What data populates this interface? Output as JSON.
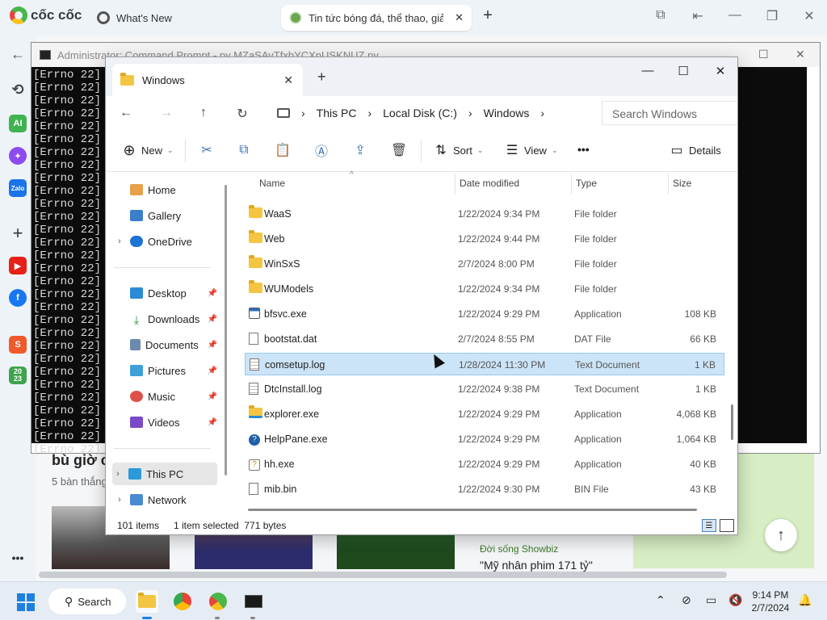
{
  "browser": {
    "logo_text": "cốc cốc",
    "tabs": [
      {
        "label": "What's New",
        "active": false
      },
      {
        "label": "Tin tức bóng đá, thể thao, giả",
        "active": true
      }
    ],
    "new_tab": "+",
    "page": {
      "headline": "bù giờ c",
      "subline": "5 bàn thắng",
      "category": "Đời sống Showbiz",
      "headline2": "\"Mỹ nhân phim 171 tỷ\"",
      "colors": {
        "category": "#3d7a2b",
        "promo_block": "#d7edc3"
      }
    }
  },
  "cmd": {
    "title": "Administrator: Command Prompt - py  MZaSAvTfxbYCXnUSKNUZ.py",
    "line_text": "[Errno 22]",
    "line_count": 30
  },
  "explorer": {
    "tab_title": "Windows",
    "new_tab": "+",
    "breadcrumbs": [
      "This PC",
      "Local Disk (C:)",
      "Windows"
    ],
    "search_placeholder": "Search Windows",
    "toolbar": {
      "new": "New",
      "sort": "Sort",
      "view": "View",
      "more": "•••",
      "details": "Details"
    },
    "nav": {
      "home": "Home",
      "gallery": "Gallery",
      "onedrive": "OneDrive",
      "desktop": "Desktop",
      "downloads": "Downloads",
      "documents": "Documents",
      "pictures": "Pictures",
      "music": "Music",
      "videos": "Videos",
      "thispc": "This PC",
      "network": "Network"
    },
    "columns": {
      "name": "Name",
      "date": "Date modified",
      "type": "Type",
      "size": "Size"
    },
    "rows": [
      {
        "name": "WaaS",
        "date": "1/22/2024 9:34 PM",
        "type": "File folder",
        "size": "",
        "icon": "folder-icon"
      },
      {
        "name": "Web",
        "date": "1/22/2024 9:44 PM",
        "type": "File folder",
        "size": "",
        "icon": "folder-icon"
      },
      {
        "name": "WinSxS",
        "date": "2/7/2024 8:00 PM",
        "type": "File folder",
        "size": "",
        "icon": "folder-icon"
      },
      {
        "name": "WUModels",
        "date": "1/22/2024 9:34 PM",
        "type": "File folder",
        "size": "",
        "icon": "folder-icon"
      },
      {
        "name": "bfsvc.exe",
        "date": "1/22/2024 9:29 PM",
        "type": "Application",
        "size": "108 KB",
        "icon": "app-window-icon"
      },
      {
        "name": "bootstat.dat",
        "date": "2/7/2024 8:55 PM",
        "type": "DAT File",
        "size": "66 KB",
        "icon": "file-icon"
      },
      {
        "name": "comsetup.log",
        "date": "1/28/2024 11:30 PM",
        "type": "Text Document",
        "size": "1 KB",
        "icon": "text-file-icon",
        "selected": true
      },
      {
        "name": "DtcInstall.log",
        "date": "1/22/2024 9:38 PM",
        "type": "Text Document",
        "size": "1 KB",
        "icon": "text-file-icon"
      },
      {
        "name": "explorer.exe",
        "date": "1/22/2024 9:29 PM",
        "type": "Application",
        "size": "4,068 KB",
        "icon": "explorer-icon"
      },
      {
        "name": "HelpPane.exe",
        "date": "1/22/2024 9:29 PM",
        "type": "Application",
        "size": "1,064 KB",
        "icon": "help-icon"
      },
      {
        "name": "hh.exe",
        "date": "1/22/2024 9:29 PM",
        "type": "Application",
        "size": "40 KB",
        "icon": "hh-icon"
      },
      {
        "name": "mib.bin",
        "date": "1/22/2024 9:30 PM",
        "type": "BIN File",
        "size": "43 KB",
        "icon": "file-icon"
      }
    ],
    "status": {
      "count": "101 items",
      "selection": "1 item selected  771 bytes"
    }
  },
  "taskbar": {
    "search": "Search",
    "time": "9:14 PM",
    "date": "2/7/2024"
  }
}
